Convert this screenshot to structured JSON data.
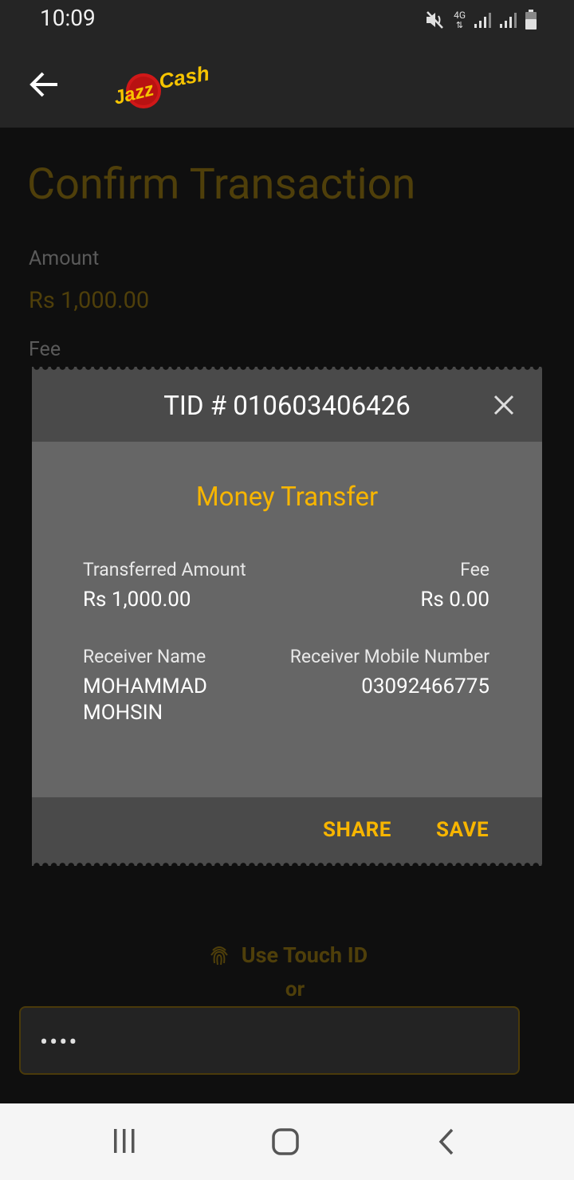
{
  "status_bar": {
    "time": "10:09",
    "network": "4G"
  },
  "app": {
    "logo_text": "JazzCash"
  },
  "background_page": {
    "title": "Confirm Transaction",
    "amount_label": "Amount",
    "amount_value": "Rs 1,000.00",
    "fee_label": "Fee",
    "touch_id_label": "Use Touch ID",
    "or_label": "or",
    "pin_masked": "••••"
  },
  "receipt": {
    "tid": "TID # 010603406426",
    "title": "Money Transfer",
    "transferred_amount_label": "Transferred Amount",
    "transferred_amount_value": "Rs 1,000.00",
    "fee_label": "Fee",
    "fee_value": "Rs 0.00",
    "receiver_name_label": "Receiver Name",
    "receiver_name_line1": "MOHAMMAD",
    "receiver_name_line2": "MOHSIN",
    "receiver_mobile_label": "Receiver Mobile Number",
    "receiver_mobile_value": "03092466775",
    "share_label": "SHARE",
    "save_label": "SAVE"
  },
  "colors": {
    "accent": "#f7b500",
    "dialog_header": "#4a4a4a",
    "dialog_body": "#666666"
  },
  "icons": [
    "back-arrow-icon",
    "close-icon",
    "fingerprint-icon",
    "mute-icon",
    "signal-icon",
    "battery-icon",
    "recents-icon",
    "home-icon",
    "nav-back-icon"
  ]
}
